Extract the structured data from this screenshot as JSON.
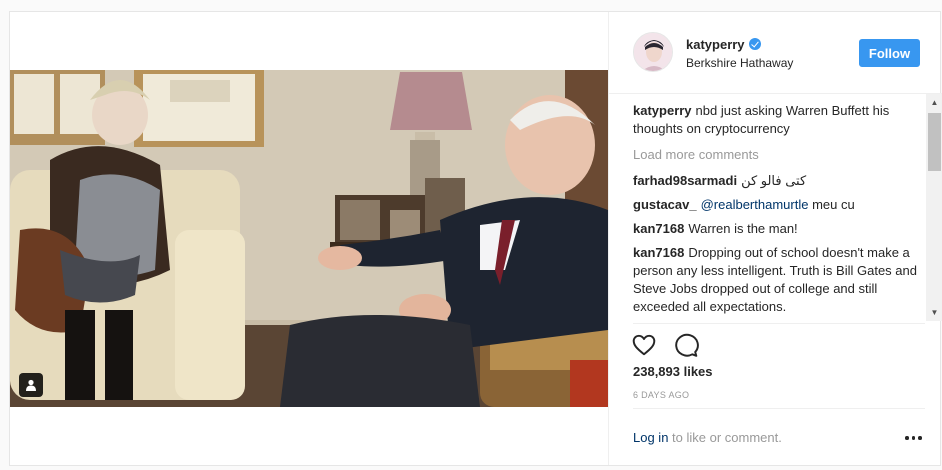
{
  "post": {
    "username": "katyperry",
    "location": "Berkshire Hathaway",
    "follow_label": "Follow",
    "caption_user": "katyperry",
    "caption_text": "nbd just asking Warren Buffett his thoughts on cryptocurrency",
    "load_more_label": "Load more comments",
    "comments": [
      {
        "user": "farhad98sarmadi",
        "text": "کتی فالو کن"
      },
      {
        "user": "gustacav_",
        "mention": "@realberthamurtle",
        "text": "meu cu"
      },
      {
        "user": "kan7168",
        "text": "Warren is the man!"
      },
      {
        "user": "kan7168",
        "text": "Dropping out of school doesn't make a person any less intelligent. Truth is Bill Gates and Steve Jobs dropped out of college and still exceeded all expectations."
      }
    ],
    "likes": "238,893 likes",
    "timestamp": "6 DAYS AGO",
    "login_link": "Log in",
    "login_suffix": "to like or comment."
  },
  "icons": {
    "verified": "verified-badge-icon",
    "like": "heart-icon",
    "comment": "comment-bubble-icon",
    "tag": "user-tag-icon",
    "more": "ellipsis-icon"
  },
  "colors": {
    "accent": "#3897f0",
    "link": "#003569",
    "muted": "#999999",
    "text": "#262626"
  }
}
